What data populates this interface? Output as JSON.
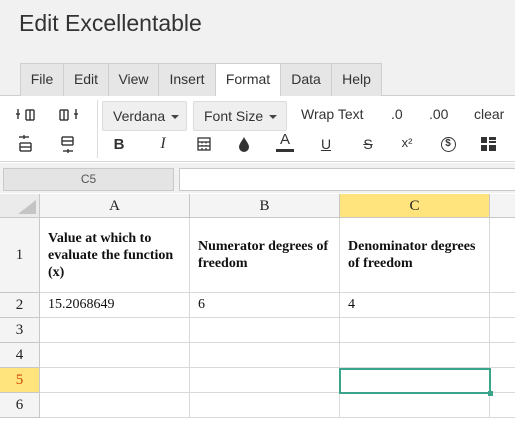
{
  "app": {
    "title": "Edit Excellentable"
  },
  "menu": {
    "tabs": [
      {
        "label": "File"
      },
      {
        "label": "Edit"
      },
      {
        "label": "View"
      },
      {
        "label": "Insert"
      },
      {
        "label": "Format"
      },
      {
        "label": "Data"
      },
      {
        "label": "Help"
      }
    ],
    "active_tab": "Format"
  },
  "toolbar": {
    "font_family": "Verdana",
    "font_size": "Font Size",
    "wrap_text": "Wrap Text",
    "decrease_decimal": ".0",
    "increase_decimal": ".00",
    "clear": "clear",
    "bold": "B",
    "italic": "I",
    "font_color": "A",
    "underline": "U",
    "strikethrough": "S",
    "superscript": "x²",
    "currency": "$"
  },
  "formula_bar": {
    "cell_ref": "C5",
    "value": ""
  },
  "sheet": {
    "columns": [
      "A",
      "B",
      "C"
    ],
    "selected_column": "C",
    "rows": [
      "1",
      "2",
      "3",
      "4",
      "5",
      "6"
    ],
    "selected_row": "5",
    "selected_cell": "C5",
    "cells": {
      "A1": "Value at which to evaluate the function (x)",
      "B1": "Numerator degrees of freedom",
      "C1": "Denominator degrees of freedom",
      "A2": "15.2068649",
      "B2": "6",
      "C2": "4"
    }
  },
  "colors": {
    "selection": "#3aa58a",
    "header_highlight": "#ffe37d",
    "row_highlight_text": "#d04a00"
  }
}
